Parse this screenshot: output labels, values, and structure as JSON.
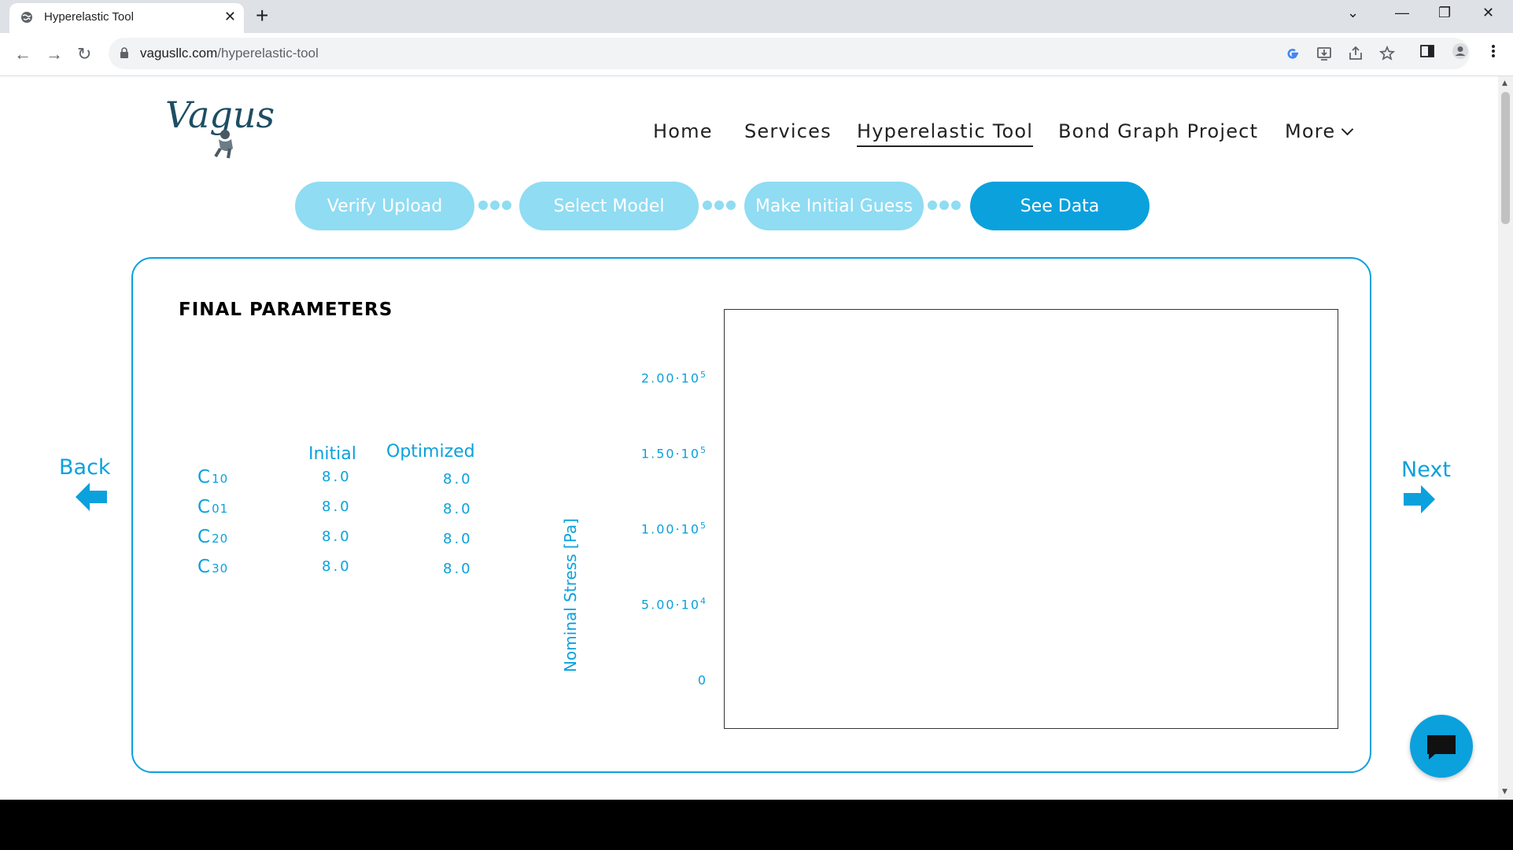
{
  "browser": {
    "tab_title": "Hyperelastic Tool",
    "url_domain": "vagusllc.com",
    "url_path": "/hyperelastic-tool",
    "icons": [
      "globe-icon",
      "close-icon",
      "plus-icon",
      "back-icon",
      "forward-icon",
      "reload-icon",
      "lock-icon",
      "google-icon",
      "install-icon",
      "share-icon",
      "star-icon",
      "sidepanel-icon",
      "profile-icon",
      "menu-icon"
    ]
  },
  "site": {
    "logo": "Vagus",
    "nav": [
      "Home",
      "Services",
      "Hyperelastic Tool",
      "Bond Graph Project",
      "More"
    ],
    "active_nav": "Hyperelastic Tool"
  },
  "steps": [
    {
      "label": "Verify Upload",
      "active": false
    },
    {
      "label": "Select Model",
      "active": false
    },
    {
      "label": "Make Initial Guess",
      "active": false
    },
    {
      "label": "See Data",
      "active": true
    }
  ],
  "card": {
    "title": "FINAL PARAMETERS",
    "col_initial": "Initial",
    "col_optimized": "Optimized",
    "params": [
      {
        "base": "C",
        "sub": "10",
        "initial": "8.0",
        "optimized": "8.0"
      },
      {
        "base": "C",
        "sub": "01",
        "initial": "8.0",
        "optimized": "8.0"
      },
      {
        "base": "C",
        "sub": "20",
        "initial": "8.0",
        "optimized": "8.0"
      },
      {
        "base": "C",
        "sub": "30",
        "initial": "8.0",
        "optimized": "8.0"
      }
    ]
  },
  "chart": {
    "y_title": "Nominal Stress [Pa]",
    "ticks": [
      {
        "mant": "2.00·10",
        "exp": "5"
      },
      {
        "mant": "1.50·10",
        "exp": "5"
      },
      {
        "mant": "1.00·10",
        "exp": "5"
      },
      {
        "mant": "5.00·10",
        "exp": "4"
      },
      {
        "mant": "0",
        "exp": ""
      }
    ]
  },
  "nav_links": {
    "back": "Back",
    "next": "Next"
  },
  "colors": {
    "accent": "#0aa1dd",
    "accent_light": "#8fdcf3",
    "logo": "#1d4e63"
  }
}
